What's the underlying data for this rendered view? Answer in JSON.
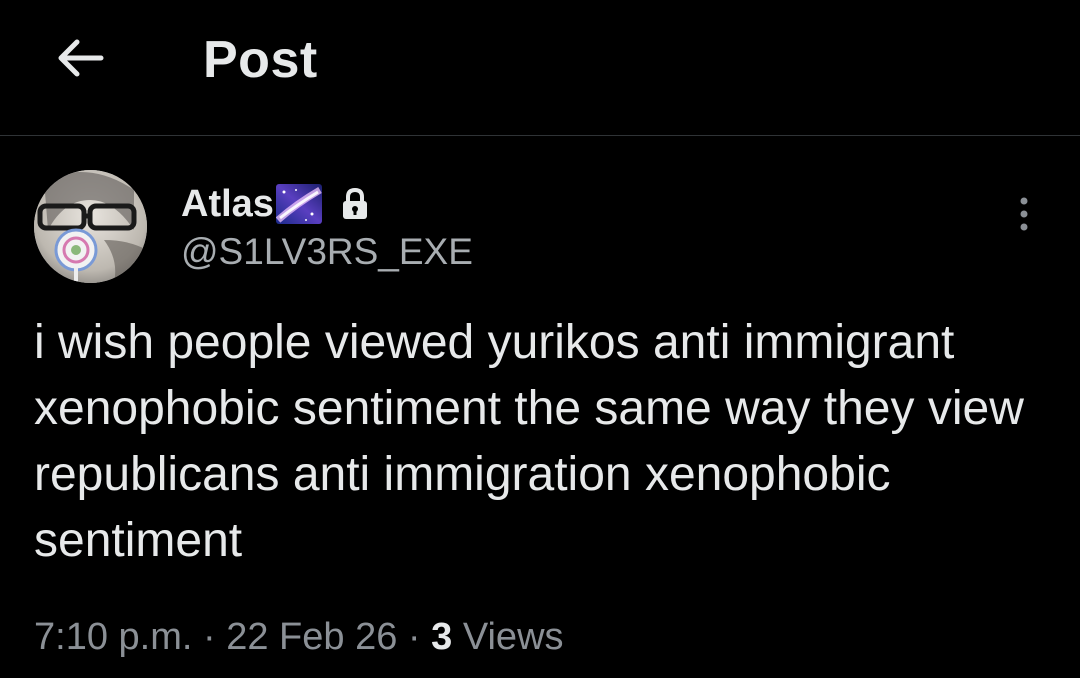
{
  "header": {
    "back_icon": "arrow-left-icon",
    "title": "Post"
  },
  "post": {
    "author": {
      "display_name": "Atlas",
      "emoji": "milky-way-emoji",
      "protected_icon": "lock-icon",
      "handle": "@S1LV3RS_EXE"
    },
    "more_icon": "more-vertical-icon",
    "text": "i wish people viewed yurikos anti immigrant xenophobic sentiment the same way they view republicans anti immigration xenophobic sentiment",
    "time": "7:10 p.m.",
    "separator": "·",
    "date": "22 Feb 26",
    "views_count": "3",
    "views_label": "Views"
  },
  "colors": {
    "background": "#000000",
    "text": "#e7e9ea",
    "secondary_text": "#8b9096",
    "divider": "#2f3336"
  }
}
